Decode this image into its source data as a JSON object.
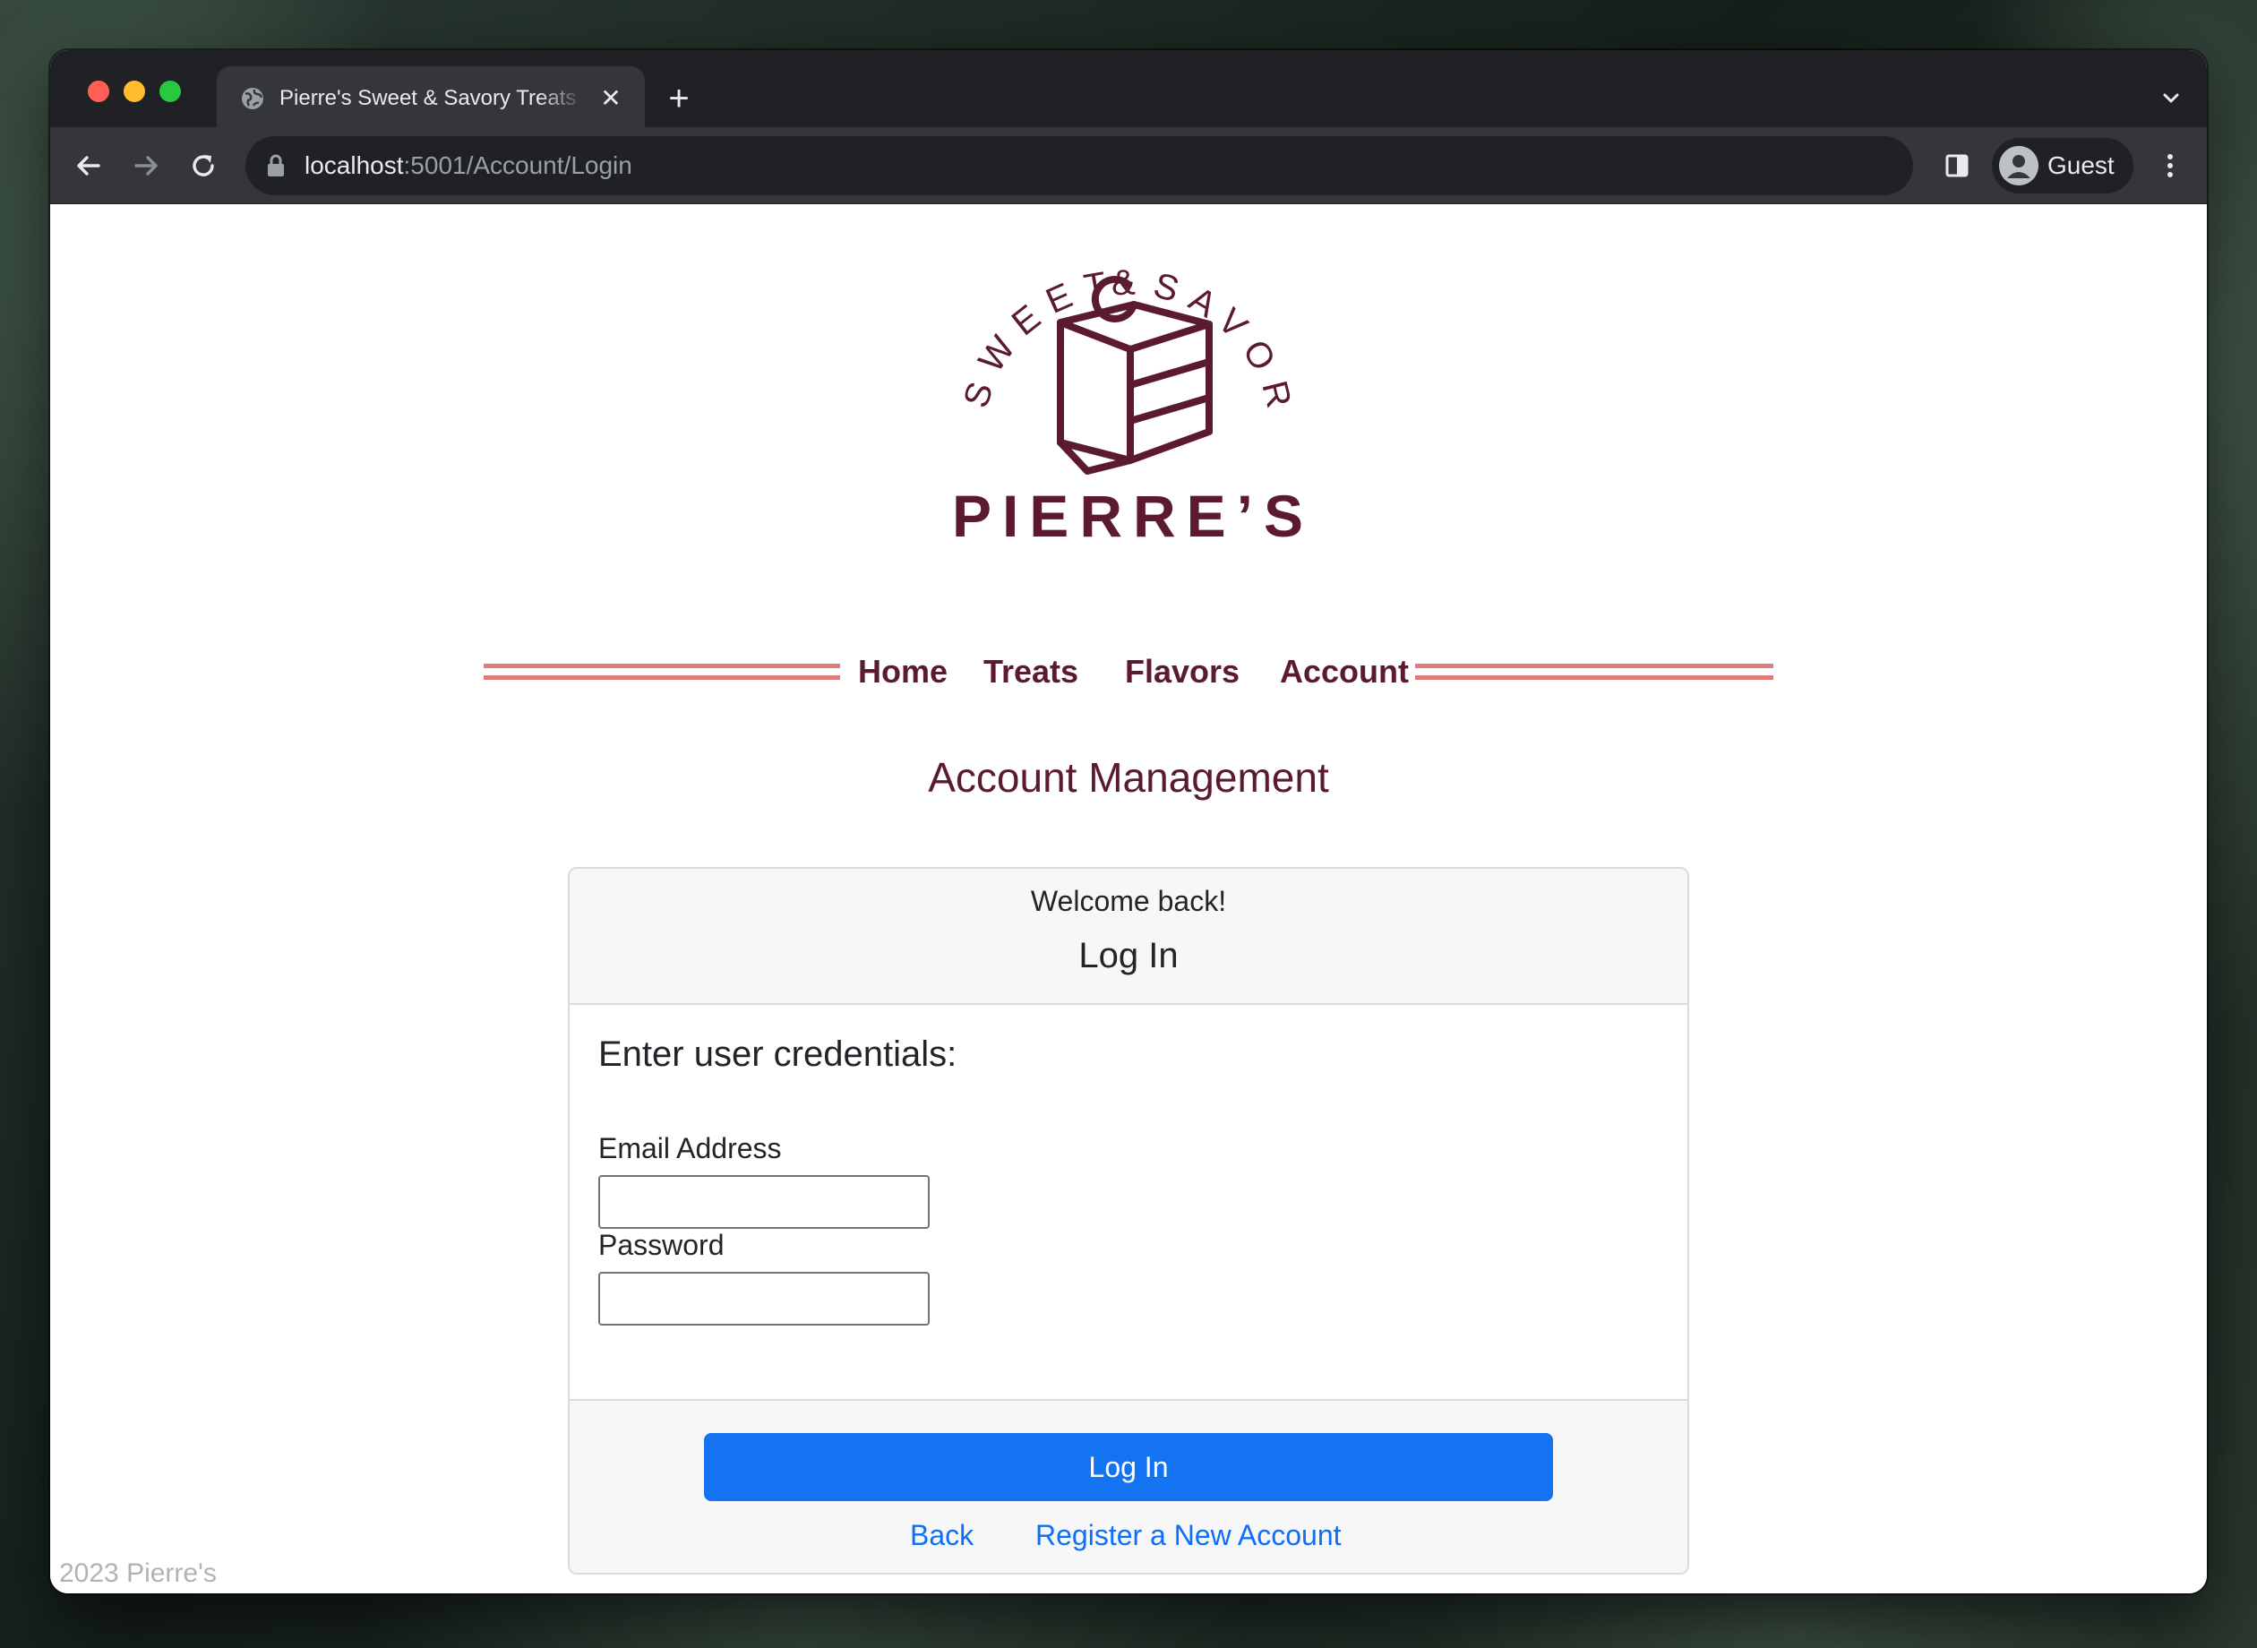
{
  "browser": {
    "tab_title": "Pierre's Sweet & Savory Treats",
    "tab_close": "✕",
    "new_tab": "+",
    "url_host": "localhost",
    "url_path": ":5001/Account/Login",
    "profile_label": "Guest"
  },
  "logo": {
    "arc_left": "SWEET",
    "arc_amp": "&",
    "arc_right": "SAVORY",
    "wordmark": "PIERRE’S",
    "brand_color": "#5c1a2e",
    "accent_color": "#e07b7b"
  },
  "nav": {
    "items": [
      {
        "label": "Home"
      },
      {
        "label": "Treats"
      },
      {
        "label": "Flavors"
      },
      {
        "label": "Account"
      }
    ]
  },
  "main": {
    "page_title": "Account Management",
    "card": {
      "welcome": "Welcome back!",
      "title": "Log In",
      "credentials_heading": "Enter user credentials:",
      "email_label": "Email Address",
      "email_value": "",
      "password_label": "Password",
      "password_value": "",
      "submit_label": "Log In",
      "submit_color": "#1473f0",
      "back_link": "Back",
      "register_link": "Register a New Account"
    }
  },
  "footer": {
    "copyright": "2023 Pierre's"
  }
}
